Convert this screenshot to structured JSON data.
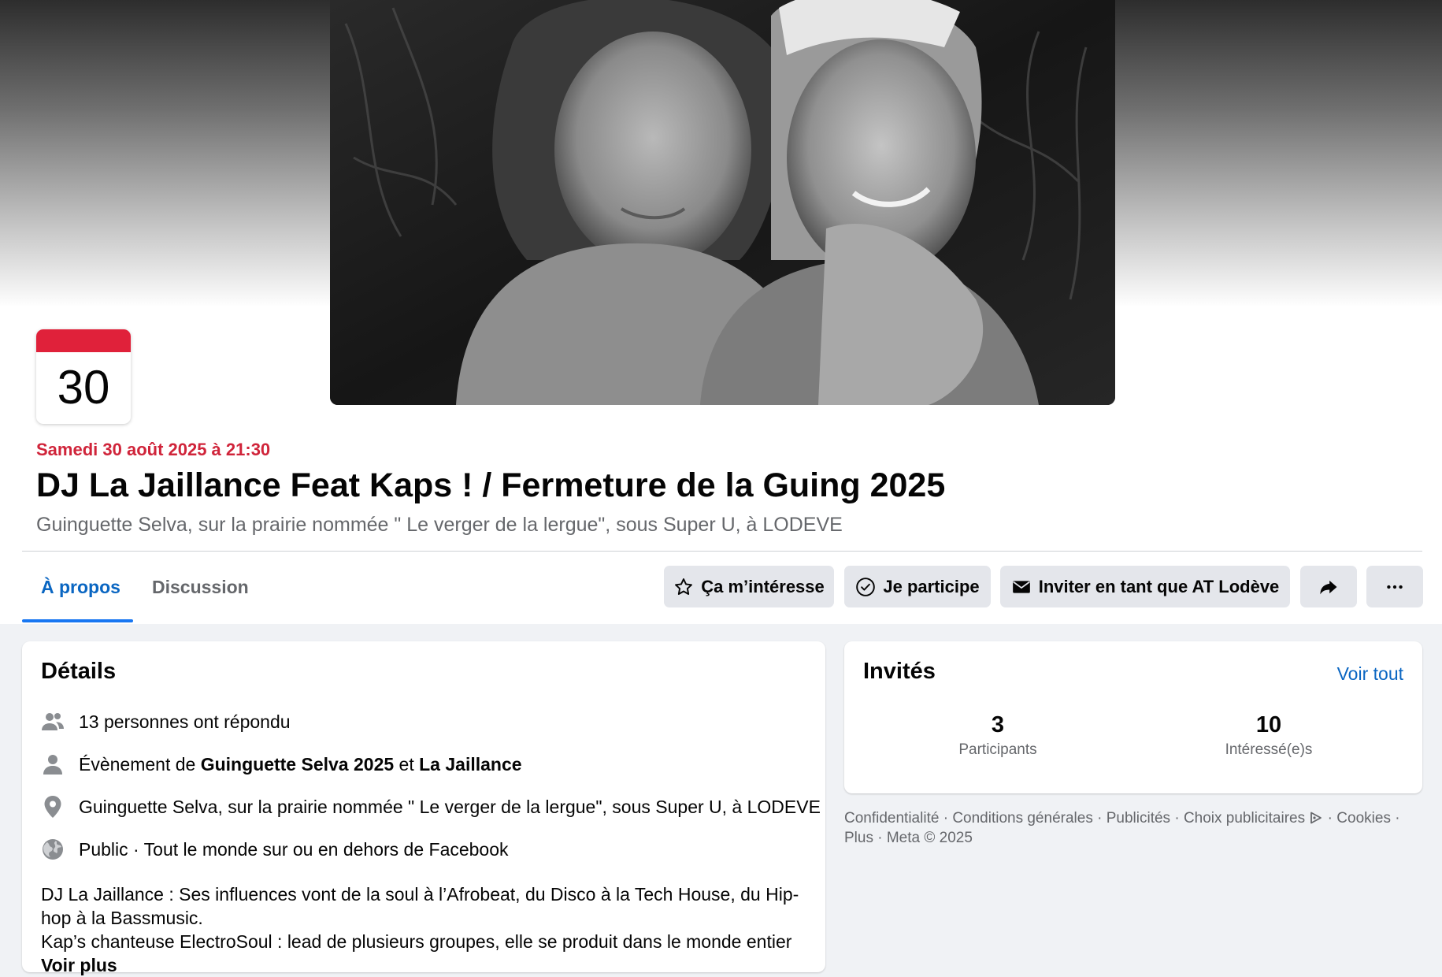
{
  "event": {
    "day": "30",
    "date_label": "Samedi 30 août 2025 à 21:30",
    "title": "DJ La Jaillance Feat Kaps ! / Fermeture de la Guing 2025",
    "location": "Guinguette Selva, sur la prairie nommée \" Le verger de la lergue\", sous Super U, à LODEVE"
  },
  "tabs": {
    "about": "À propos",
    "discussion": "Discussion"
  },
  "actions": {
    "interested": "Ça m’intéresse",
    "going": "Je participe",
    "invite": "Inviter en tant que AT Lodève"
  },
  "details": {
    "heading": "Détails",
    "responded": "13 personnes ont répondu",
    "event_by_prefix": "Évènement de",
    "host1": "Guinguette Selva 2025",
    "host_sep": "et",
    "host2": "La Jaillance",
    "location": "Guinguette Selva, sur la prairie nommée \" Le verger de la lergue\", sous Super U, à LODEVE",
    "privacy": "Public · Tout le monde sur ou en dehors de Facebook",
    "desc_line1": "DJ La Jaillance : Ses influences vont de la soul à l’Afrobeat, du Disco à la Tech House, du Hip-hop à la Bassmusic.",
    "desc_line2": "Kap’s chanteuse ElectroSoul : lead de plusieurs groupes, elle se produit dans le monde entier",
    "see_more": "Voir plus"
  },
  "guests": {
    "heading": "Invités",
    "see_all": "Voir tout",
    "participants_count": "3",
    "participants_label": "Participants",
    "interested_count": "10",
    "interested_label": "Intéressé(e)s"
  },
  "footer": {
    "privacy": "Confidentialité",
    "terms": "Conditions générales",
    "ads": "Publicités",
    "ad_choices": "Choix publicitaires",
    "cookies": "Cookies",
    "more": "Plus",
    "copyright": "Meta © 2025"
  },
  "colors": {
    "accent_blue": "#0a66c2",
    "date_red": "#d0243a",
    "badge_red": "#e0213a",
    "button_gray": "#e4e6eb"
  }
}
